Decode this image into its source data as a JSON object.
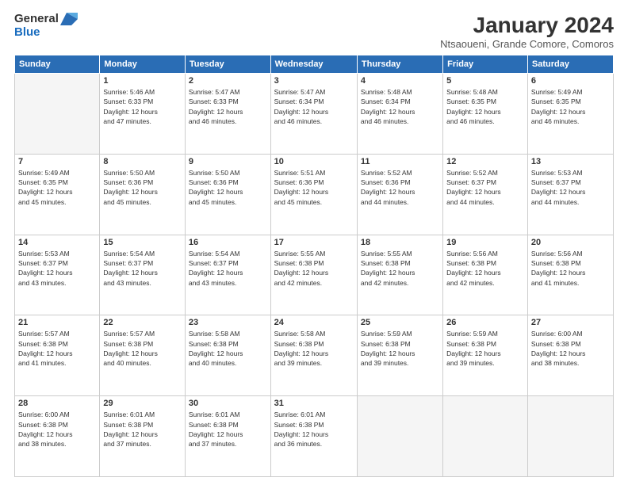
{
  "logo": {
    "line1": "General",
    "line2": "Blue"
  },
  "title": "January 2024",
  "subtitle": "Ntsaoueni, Grande Comore, Comoros",
  "days_of_week": [
    "Sunday",
    "Monday",
    "Tuesday",
    "Wednesday",
    "Thursday",
    "Friday",
    "Saturday"
  ],
  "weeks": [
    [
      {
        "day": "",
        "info": ""
      },
      {
        "day": "1",
        "info": "Sunrise: 5:46 AM\nSunset: 6:33 PM\nDaylight: 12 hours\nand 47 minutes."
      },
      {
        "day": "2",
        "info": "Sunrise: 5:47 AM\nSunset: 6:33 PM\nDaylight: 12 hours\nand 46 minutes."
      },
      {
        "day": "3",
        "info": "Sunrise: 5:47 AM\nSunset: 6:34 PM\nDaylight: 12 hours\nand 46 minutes."
      },
      {
        "day": "4",
        "info": "Sunrise: 5:48 AM\nSunset: 6:34 PM\nDaylight: 12 hours\nand 46 minutes."
      },
      {
        "day": "5",
        "info": "Sunrise: 5:48 AM\nSunset: 6:35 PM\nDaylight: 12 hours\nand 46 minutes."
      },
      {
        "day": "6",
        "info": "Sunrise: 5:49 AM\nSunset: 6:35 PM\nDaylight: 12 hours\nand 46 minutes."
      }
    ],
    [
      {
        "day": "7",
        "info": "Sunrise: 5:49 AM\nSunset: 6:35 PM\nDaylight: 12 hours\nand 45 minutes."
      },
      {
        "day": "8",
        "info": "Sunrise: 5:50 AM\nSunset: 6:36 PM\nDaylight: 12 hours\nand 45 minutes."
      },
      {
        "day": "9",
        "info": "Sunrise: 5:50 AM\nSunset: 6:36 PM\nDaylight: 12 hours\nand 45 minutes."
      },
      {
        "day": "10",
        "info": "Sunrise: 5:51 AM\nSunset: 6:36 PM\nDaylight: 12 hours\nand 45 minutes."
      },
      {
        "day": "11",
        "info": "Sunrise: 5:52 AM\nSunset: 6:36 PM\nDaylight: 12 hours\nand 44 minutes."
      },
      {
        "day": "12",
        "info": "Sunrise: 5:52 AM\nSunset: 6:37 PM\nDaylight: 12 hours\nand 44 minutes."
      },
      {
        "day": "13",
        "info": "Sunrise: 5:53 AM\nSunset: 6:37 PM\nDaylight: 12 hours\nand 44 minutes."
      }
    ],
    [
      {
        "day": "14",
        "info": "Sunrise: 5:53 AM\nSunset: 6:37 PM\nDaylight: 12 hours\nand 43 minutes."
      },
      {
        "day": "15",
        "info": "Sunrise: 5:54 AM\nSunset: 6:37 PM\nDaylight: 12 hours\nand 43 minutes."
      },
      {
        "day": "16",
        "info": "Sunrise: 5:54 AM\nSunset: 6:37 PM\nDaylight: 12 hours\nand 43 minutes."
      },
      {
        "day": "17",
        "info": "Sunrise: 5:55 AM\nSunset: 6:38 PM\nDaylight: 12 hours\nand 42 minutes."
      },
      {
        "day": "18",
        "info": "Sunrise: 5:55 AM\nSunset: 6:38 PM\nDaylight: 12 hours\nand 42 minutes."
      },
      {
        "day": "19",
        "info": "Sunrise: 5:56 AM\nSunset: 6:38 PM\nDaylight: 12 hours\nand 42 minutes."
      },
      {
        "day": "20",
        "info": "Sunrise: 5:56 AM\nSunset: 6:38 PM\nDaylight: 12 hours\nand 41 minutes."
      }
    ],
    [
      {
        "day": "21",
        "info": "Sunrise: 5:57 AM\nSunset: 6:38 PM\nDaylight: 12 hours\nand 41 minutes."
      },
      {
        "day": "22",
        "info": "Sunrise: 5:57 AM\nSunset: 6:38 PM\nDaylight: 12 hours\nand 40 minutes."
      },
      {
        "day": "23",
        "info": "Sunrise: 5:58 AM\nSunset: 6:38 PM\nDaylight: 12 hours\nand 40 minutes."
      },
      {
        "day": "24",
        "info": "Sunrise: 5:58 AM\nSunset: 6:38 PM\nDaylight: 12 hours\nand 39 minutes."
      },
      {
        "day": "25",
        "info": "Sunrise: 5:59 AM\nSunset: 6:38 PM\nDaylight: 12 hours\nand 39 minutes."
      },
      {
        "day": "26",
        "info": "Sunrise: 5:59 AM\nSunset: 6:38 PM\nDaylight: 12 hours\nand 39 minutes."
      },
      {
        "day": "27",
        "info": "Sunrise: 6:00 AM\nSunset: 6:38 PM\nDaylight: 12 hours\nand 38 minutes."
      }
    ],
    [
      {
        "day": "28",
        "info": "Sunrise: 6:00 AM\nSunset: 6:38 PM\nDaylight: 12 hours\nand 38 minutes."
      },
      {
        "day": "29",
        "info": "Sunrise: 6:01 AM\nSunset: 6:38 PM\nDaylight: 12 hours\nand 37 minutes."
      },
      {
        "day": "30",
        "info": "Sunrise: 6:01 AM\nSunset: 6:38 PM\nDaylight: 12 hours\nand 37 minutes."
      },
      {
        "day": "31",
        "info": "Sunrise: 6:01 AM\nSunset: 6:38 PM\nDaylight: 12 hours\nand 36 minutes."
      },
      {
        "day": "",
        "info": ""
      },
      {
        "day": "",
        "info": ""
      },
      {
        "day": "",
        "info": ""
      }
    ]
  ]
}
